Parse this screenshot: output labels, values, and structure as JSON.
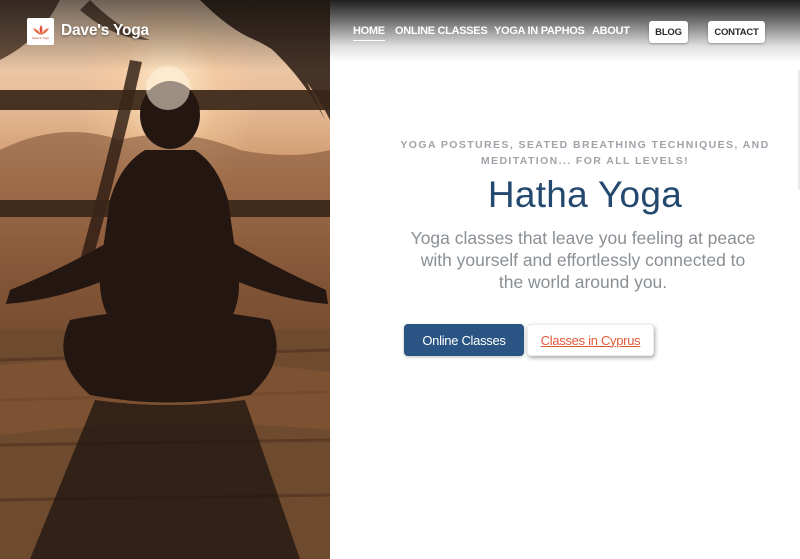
{
  "brand": {
    "name": "Dave's Yoga",
    "logo_small_text": "Dave's Yoga"
  },
  "nav": {
    "links": [
      {
        "label": "HOME"
      },
      {
        "label": "ONLINE CLASSES"
      },
      {
        "label": "YOGA IN PAPHOS"
      },
      {
        "label": "ABOUT"
      }
    ],
    "blog_label": "BLOG",
    "contact_label": "CONTACT"
  },
  "hero": {
    "tagline": "YOGA POSTURES, SEATED BREATHING TECHNIQUES, AND MEDITATION... FOR ALL LEVELS!",
    "title": "Hatha Yoga",
    "subtitle": "Yoga classes that leave you feeling at peace with yourself and effortlessly connected to the world around you.",
    "primary_button": "Online Classes",
    "secondary_button": "Classes in Cyprus"
  },
  "colors": {
    "title": "#24496e",
    "primary_button": "#2a5483",
    "secondary_button_text": "#e25a3b",
    "tagline": "#9ea4aa"
  }
}
